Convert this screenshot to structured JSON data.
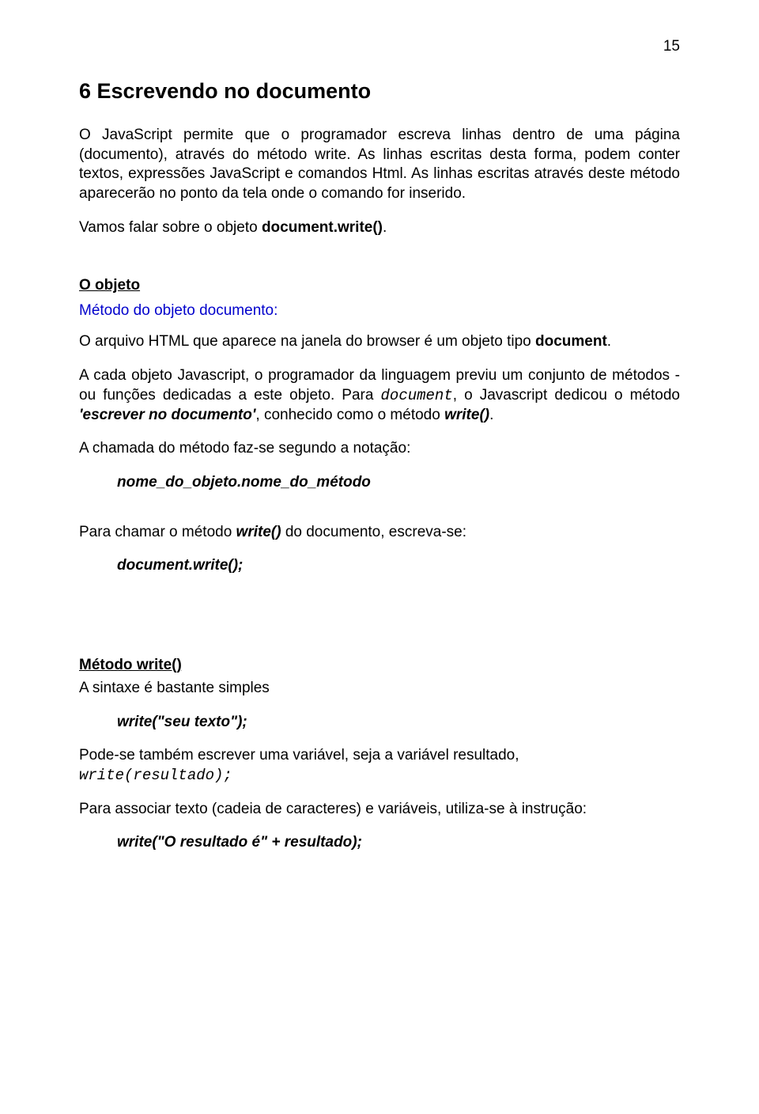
{
  "page_number": "15",
  "h1": "6  Escrevendo no documento",
  "p1": "O JavaScript permite que o programador escreva linhas dentro de uma página (documento), através do método write. As linhas escritas desta forma, podem conter textos, expressões JavaScript e comandos Html. As linhas escritas através deste método aparecerão no ponto da tela onde o comando for inserido.",
  "p2a": "Vamos falar sobre o objeto ",
  "p2b": "document.write()",
  "p2c": ".",
  "subhead1": "O objeto",
  "blue1": "Método do objeto documento:",
  "p3a": "O arquivo HTML que aparece na janela do browser é um objeto tipo ",
  "p3b": "document",
  "p3c": ".",
  "p4a": "A cada objeto Javascript, o programador da linguagem previu um conjunto de métodos - ou funções dedicadas a este objeto. Para ",
  "p4b": "document",
  "p4c": ", o Javascript dedicou o método ",
  "p4d": "'escrever no documento'",
  "p4e": ", conhecido como o método ",
  "p4f": "write()",
  "p4g": ".",
  "p5": "A chamada do método faz-se segundo a notação:",
  "indent1": "nome_do_objeto.nome_do_método",
  "p6a": "Para chamar o método ",
  "p6b": "write()",
  "p6c": " do documento, escreva-se:",
  "indent2": "document.write();",
  "subhead2": "Método write()",
  "p7": "A sintaxe é bastante simples",
  "indent3": "write(\"seu texto\");",
  "p8a": "Pode-se também escrever uma variável, seja a variável resultado,",
  "p8b": "write(resultado);",
  "p9": "Para associar texto (cadeia de caracteres) e variáveis, utiliza-se à instrução:",
  "indent4": "write(\"O resultado é\" + resultado);"
}
